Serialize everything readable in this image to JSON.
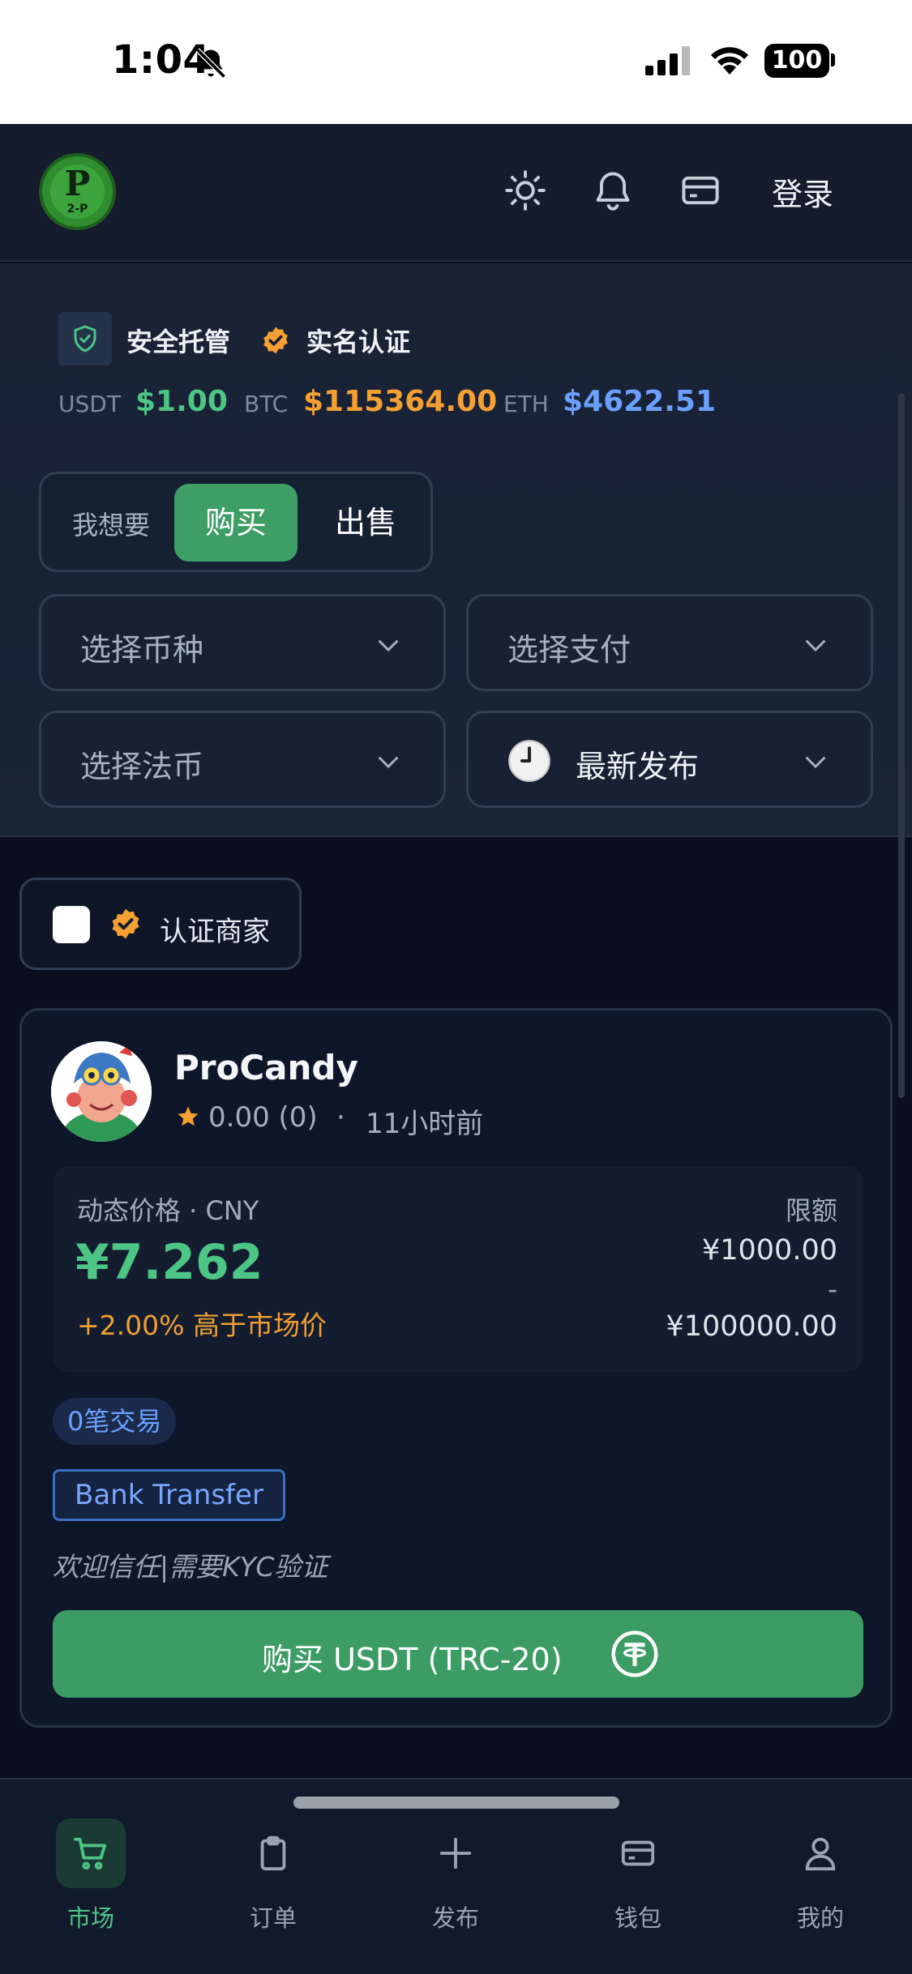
{
  "status_bar": {
    "time": "1:04",
    "battery": "100"
  },
  "header": {
    "logo_text": "P",
    "logo_sub": "2-P",
    "login_label": "登录"
  },
  "hero": {
    "badges": {
      "secure": "安全托管",
      "realname": "实名认证"
    },
    "tickers": [
      {
        "symbol": "USDT",
        "price": "$1.00",
        "color": "#4cc585"
      },
      {
        "symbol": "BTC",
        "price": "$115364.00",
        "color": "#f5a033"
      },
      {
        "symbol": "ETH",
        "price": "$4622.51",
        "color": "#6aa0ff"
      }
    ],
    "toggle": {
      "prefix": "我想要",
      "buy": "购买",
      "sell": "出售"
    },
    "selects": {
      "coin": "选择币种",
      "payment": "选择支付",
      "fiat": "选择法币",
      "sort": "最新发布"
    }
  },
  "filter": {
    "verified_merchant": "认证商家"
  },
  "offer": {
    "merchant": "ProCandy",
    "rating": "0.00 (0)",
    "separator": "·",
    "time_ago": "11小时前",
    "price_label": "动态价格 · CNY",
    "price": "¥7.262",
    "price_diff": "+2.00% 高于市场价",
    "limit_label": "限额",
    "limit_min": "¥1000.00",
    "limit_dash": "-",
    "limit_max": "¥100000.00",
    "trade_count": "0笔交易",
    "payment_method": "Bank Transfer",
    "remark": "欢迎信任|需要KYC验证",
    "buy_button": "购买 USDT (TRC-20)"
  },
  "tabs": [
    {
      "label": "市场",
      "icon": "cart-icon",
      "active": true
    },
    {
      "label": "订单",
      "icon": "clipboard-icon",
      "active": false
    },
    {
      "label": "发布",
      "icon": "plus-icon",
      "active": false
    },
    {
      "label": "钱包",
      "icon": "wallet-icon",
      "active": false
    },
    {
      "label": "我的",
      "icon": "user-icon",
      "active": false
    }
  ],
  "colors": {
    "accent_green": "#3f9e66",
    "price_green": "#4cc585",
    "warning_orange": "#f0a030",
    "link_blue": "#6aa0ff"
  }
}
